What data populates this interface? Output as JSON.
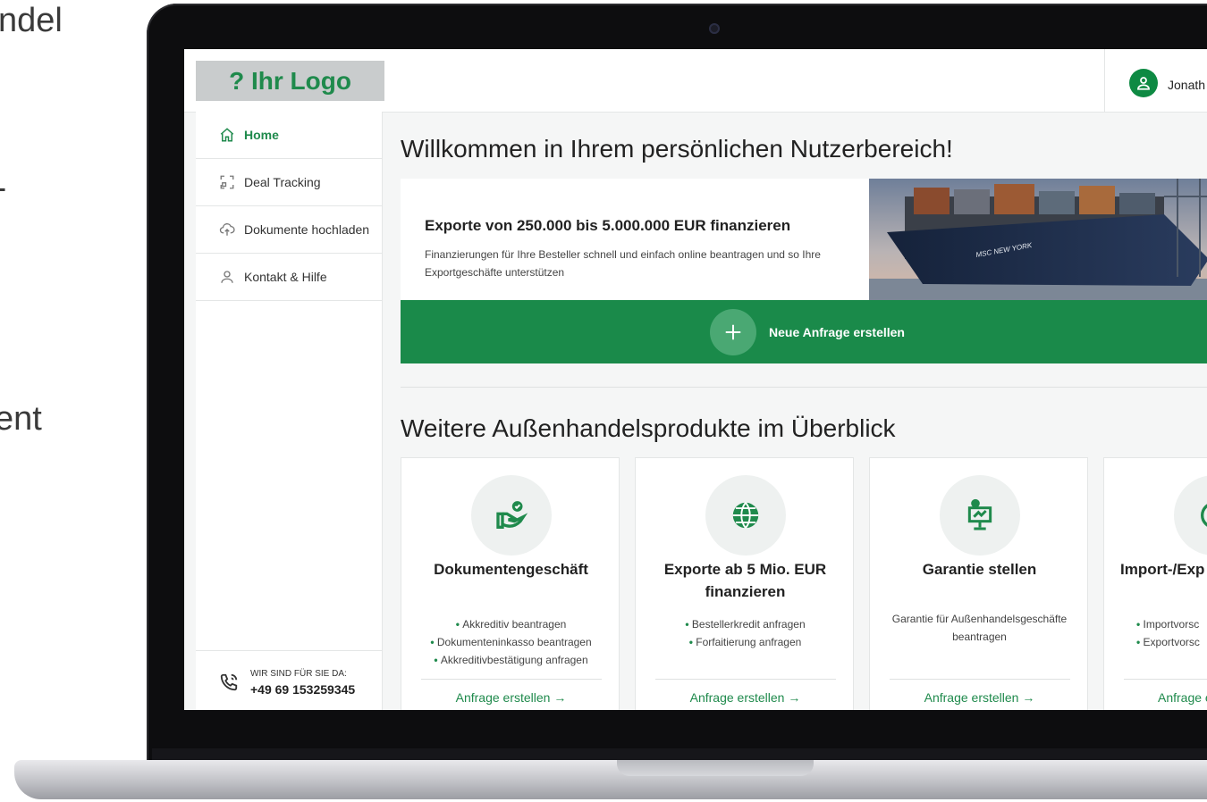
{
  "background_text": [
    "ndel",
    "-",
    "ent"
  ],
  "logo": {
    "text": "? Ihr Logo"
  },
  "user": {
    "name": "Jonath"
  },
  "sidebar": {
    "items": [
      {
        "label": "Home",
        "icon": "home-icon",
        "active": true
      },
      {
        "label": "Deal Tracking",
        "icon": "scan-frame-icon",
        "active": false
      },
      {
        "label": "Dokumente hochladen",
        "icon": "cloud-upload-icon",
        "active": false
      },
      {
        "label": "Kontakt & Hilfe",
        "icon": "user-icon",
        "active": false
      }
    ],
    "contact": {
      "caption": "WIR SIND FÜR SIE DA:",
      "phone": "+49 69 153259345",
      "icon": "phone-icon"
    }
  },
  "main": {
    "welcome_title": "Willkommen in Ihrem persönlichen Nutzerbereich!",
    "hero": {
      "title": "Exporte von 250.000 bis 5.000.000 EUR finanzieren",
      "description": "Finanzierungen für Ihre Besteller schnell und einfach online beantragen und so Ihre Exportgeschäfte unterstützen",
      "image_caption": "MSC NEW YORK"
    },
    "cta": {
      "label": "Neue Anfrage erstellen",
      "icon": "plus-icon"
    },
    "products_title": "Weitere Außenhandelsprodukte im Überblick",
    "products": [
      {
        "title": "Dokumentengeschäft",
        "icon": "hand-check-icon",
        "items": [
          "Akkreditiv beantragen",
          "Dokumenteninkasso beantragen",
          "Akkreditivbestätigung anfragen"
        ],
        "link": "Anfrage erstellen →"
      },
      {
        "title": "Exporte ab 5 Mio. EUR finanzieren",
        "icon": "globe-icon",
        "items": [
          "Bestellerkredit anfragen",
          "Forfaitierung anfragen"
        ],
        "link": "Anfrage erstellen →"
      },
      {
        "title": "Garantie stellen",
        "icon": "presentation-icon",
        "description": "Garantie für Außenhandelsgeschäfte beantragen",
        "items": [],
        "link": "Anfrage erstellen →"
      },
      {
        "title": "Import-/Exp",
        "icon": "circle-icon",
        "items": [
          "Importvorsc",
          "Exportvorsc"
        ],
        "link": "Anfrage e"
      }
    ]
  },
  "colors": {
    "primary": "#1a8a4a",
    "logo_bg": "#c9cccd",
    "page_bg": "#f5f6f6"
  }
}
